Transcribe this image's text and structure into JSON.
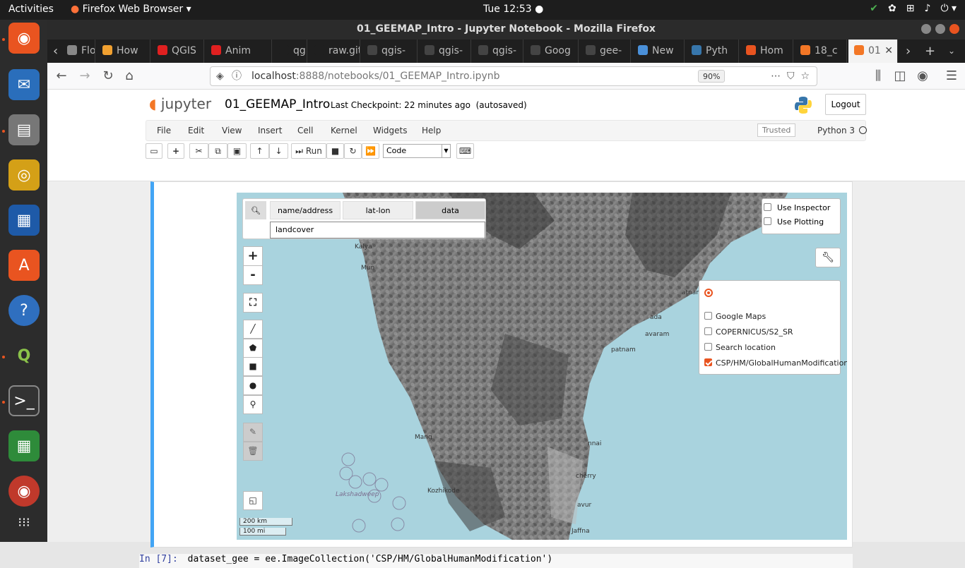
{
  "gnome": {
    "activities": "Activities",
    "app_name": "Firefox Web Browser",
    "clock": "Tue 12:53"
  },
  "firefox": {
    "window_title": "01_GEEMAP_Intro - Jupyter Notebook - Mozilla Firefox",
    "tabs": [
      {
        "label": "Flooc",
        "color": "#888888"
      },
      {
        "label": "How",
        "color": "#f0a030"
      },
      {
        "label": "QGIS",
        "color": "#e02020"
      },
      {
        "label": "Anim",
        "color": "#e02020"
      },
      {
        "label": "qgis-ear",
        "color": "#1f1f1f"
      },
      {
        "label": "raw.gith",
        "color": "#1f1f1f"
      },
      {
        "label": "qgis-",
        "color": "#444444"
      },
      {
        "label": "qgis-",
        "color": "#444444"
      },
      {
        "label": "qgis-",
        "color": "#444444"
      },
      {
        "label": "Goog",
        "color": "#444444"
      },
      {
        "label": "gee-",
        "color": "#444444"
      },
      {
        "label": "New",
        "color": "#4a90d9"
      },
      {
        "label": "Pyth",
        "color": "#3776ab"
      },
      {
        "label": "Hom",
        "color": "#e95420"
      },
      {
        "label": "18_c",
        "color": "#f37726"
      },
      {
        "label": "01",
        "color": "#f37726"
      }
    ],
    "url_host": "localhost",
    "url_path": ":8888/notebooks/01_GEEMAP_Intro.ipynb",
    "zoom": "90%"
  },
  "jupyter": {
    "logo": "jupyter",
    "notebook_title": "01_GEEMAP_Intro",
    "checkpoint": "Last Checkpoint: 22 minutes ago",
    "autosaved": "(autosaved)",
    "logout": "Logout",
    "menu": [
      "File",
      "Edit",
      "View",
      "Insert",
      "Cell",
      "Kernel",
      "Widgets",
      "Help"
    ],
    "trusted": "Trusted",
    "kernel": "Python 3",
    "run_label": "Run",
    "cell_type": "Code"
  },
  "map": {
    "search_tabs": [
      "name/address",
      "lat-lon",
      "data"
    ],
    "search_value": "landcover",
    "inspector": "Use Inspector",
    "plotting": "Use Plotting",
    "layers": [
      {
        "name": "Google Maps",
        "checked": false
      },
      {
        "name": "COPERNICUS/S2_SR",
        "checked": false
      },
      {
        "name": "Search location",
        "checked": false
      },
      {
        "name": "CSP/HM/GlobalHumanModification",
        "checked": true
      }
    ],
    "scale_km": "200 km",
    "scale_mi": "100 mi",
    "place_labels": [
      "Kalya",
      "Mun",
      "atnam",
      "ada",
      "avaram",
      "patnam",
      "Mang",
      "nnai",
      "Kozhikode",
      "cherry",
      "avur",
      "Jaffna",
      "Lakshadweep"
    ]
  },
  "next_cell": {
    "prompt": "In [7]:",
    "code": "dataset_gee = ee.ImageCollection('CSP/HM/GlobalHumanModification')"
  }
}
